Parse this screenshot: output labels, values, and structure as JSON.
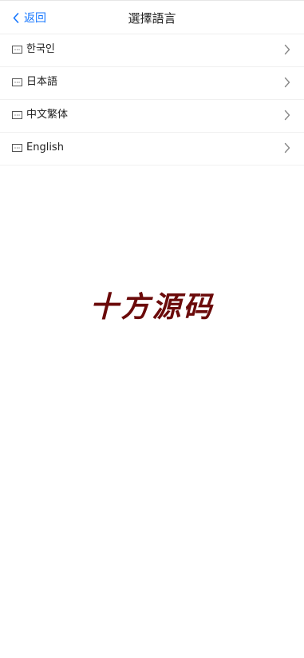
{
  "header": {
    "back_label": "返回",
    "title": "選擇語言"
  },
  "languages": [
    {
      "label": "한국인",
      "icon": "flag-icon"
    },
    {
      "label": "日本語",
      "icon": "flag-icon"
    },
    {
      "label": "中文繁体",
      "icon": "flag-icon"
    },
    {
      "label": "English",
      "icon": "flag-icon"
    }
  ],
  "watermark": "十方源码",
  "colors": {
    "accent": "#1677ff",
    "watermark": "#6b0a0a",
    "divider": "#eeeeee"
  }
}
